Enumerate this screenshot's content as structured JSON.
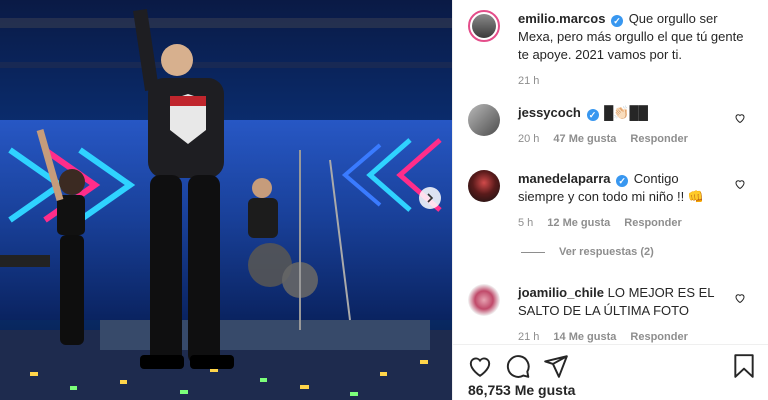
{
  "post": {
    "author": "emilio.marcos",
    "caption": "Que orgullo ser Mexa, pero más orgullo el que tú gente te apoye. 2021 vamos por ti.",
    "time": "21 h"
  },
  "comments": [
    {
      "user": "jessycoch",
      "verified": true,
      "text": "█👏🏻██",
      "time": "20 h",
      "likes": "47 Me gusta",
      "reply": "Responder"
    },
    {
      "user": "manedelaparra",
      "verified": true,
      "text": "Contigo siempre y con todo mi niño !! 👊",
      "time": "5 h",
      "likes": "12 Me gusta",
      "reply": "Responder"
    },
    {
      "user": "joamilio_chile",
      "verified": false,
      "text": "LO MEJOR ES EL SALTO DE LA ÚLTIMA FOTO",
      "time": "21 h",
      "likes": "14 Me gusta",
      "reply": "Responder"
    }
  ],
  "view_replies": "Ver respuestas (2)",
  "likes_count": "86,753",
  "likes_label": "Me gusta",
  "icons": {
    "like": "heart-icon",
    "comment": "comment-icon",
    "share": "paper-plane-icon",
    "save": "bookmark-icon",
    "next": "chevron-right-icon"
  },
  "colors": {
    "link": "#3897f0",
    "muted": "#8e8e8e",
    "text": "#262626"
  }
}
